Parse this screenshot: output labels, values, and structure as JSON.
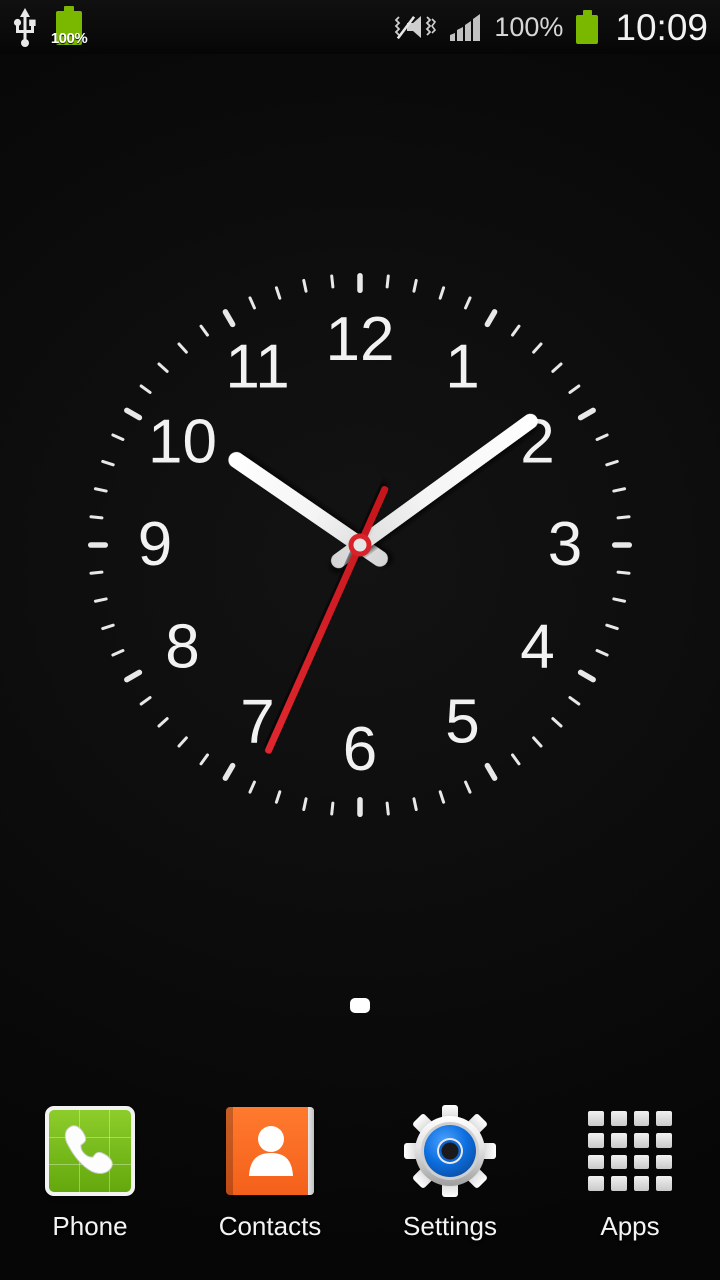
{
  "status_bar": {
    "left_icons": [
      {
        "name": "usb-icon",
        "label": "USB connected"
      },
      {
        "name": "battery-charging-icon",
        "label": "100%"
      }
    ],
    "battery_left_percent": "100%",
    "right_icons": [
      {
        "name": "sound-mute-vibrate-icon",
        "label": "Mute / vibrate"
      },
      {
        "name": "signal-bars-icon",
        "label": "Signal 4 bars"
      }
    ],
    "battery_percent": "100%",
    "battery_icon": "battery-full-icon",
    "time": "10:09",
    "colors": {
      "battery_green": "#7ab800",
      "text": "#f2f2f2"
    }
  },
  "clock_widget": {
    "name": "analog-clock-widget",
    "hour_numbers": [
      "12",
      "1",
      "2",
      "3",
      "4",
      "5",
      "6",
      "7",
      "8",
      "9",
      "10",
      "11"
    ],
    "hands": {
      "hour_angle_deg": 304.5,
      "minute_angle_deg": 54,
      "second_angle_deg": 204
    },
    "displayed_time": "10:09",
    "colors": {
      "face": "#0c0c0c",
      "numerals": "#f2f2f2",
      "ticks": "#e8e8e8",
      "hour_hand": "#f0f0f0",
      "minute_hand": "#f0f0f0",
      "second_hand": "#d8232a",
      "hub_ring": "#d8232a",
      "hub_center": "#e6e6e6"
    }
  },
  "page_indicator": {
    "name": "home-page-indicator",
    "pages": 1,
    "current_page": 1
  },
  "dock": {
    "items": [
      {
        "label": "Phone",
        "icon": "phone-icon"
      },
      {
        "label": "Contacts",
        "icon": "contacts-icon"
      },
      {
        "label": "Settings",
        "icon": "settings-gear-icon"
      },
      {
        "label": "Apps",
        "icon": "apps-grid-icon"
      }
    ]
  }
}
